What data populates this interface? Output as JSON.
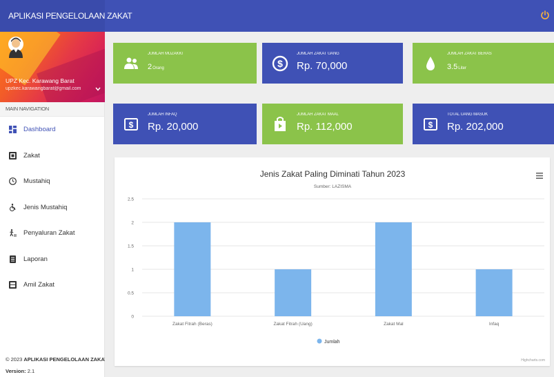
{
  "app": {
    "title": "APLIKASI PENGELOLAAN ZAKAT"
  },
  "profile": {
    "name": "UPZ Kec. Karawang Barat",
    "email": "upzkec.karawangbarat@gmail.com"
  },
  "nav": {
    "header": "MAIN NAVIGATION",
    "items": [
      {
        "label": "Dashboard",
        "icon": "dashboard-icon",
        "active": true
      },
      {
        "label": "Zakat",
        "icon": "zakat-icon"
      },
      {
        "label": "Mustahiq",
        "icon": "mustahiq-icon"
      },
      {
        "label": "Jenis Mustahiq",
        "icon": "wheelchair-icon"
      },
      {
        "label": "Penyaluran Zakat",
        "icon": "walking-icon"
      },
      {
        "label": "Laporan",
        "icon": "report-icon"
      },
      {
        "label": "Amil Zakat",
        "icon": "amil-icon"
      }
    ]
  },
  "footer": {
    "copyright_prefix": "© 2023 ",
    "copyright_app": "APLIKASI PENGELOLAAN ZAKAT.",
    "version_label": "Version:",
    "version": "2.1"
  },
  "cards": [
    {
      "label": "JUMLAH MUZAKKI",
      "value": "2",
      "unit": "Orang",
      "color": "#8bc34a",
      "icon": "users-icon"
    },
    {
      "label": "JUMLAH ZAKAT UANG",
      "value": "Rp. 70,000",
      "color": "#3f51b5",
      "icon": "dollar-icon"
    },
    {
      "label": "JUMLAH ZAKAT BERAS",
      "value": "3.5",
      "unit": "Liter",
      "color": "#8bc34a",
      "icon": "drop-icon"
    },
    {
      "label": "JUMLAH INFAQ",
      "value": "Rp. 20,000",
      "color": "#3f51b5",
      "icon": "money-icon"
    },
    {
      "label": "JUMLAH ZAKAT MAAL",
      "value": "Rp. 112,000",
      "color": "#8bc34a",
      "icon": "bag-icon"
    },
    {
      "label": "TOTAL UANG MASUK",
      "value": "Rp. 202,000",
      "color": "#3f51b5",
      "icon": "money-icon"
    }
  ],
  "colors": {
    "primary": "#3f51b5",
    "green": "#8bc34a",
    "bar": "#7cb5ec"
  },
  "chart_data": {
    "type": "bar",
    "title": "Jenis Zakat Paling Diminati Tahun 2023",
    "subtitle": "Sumber: LAZISMA",
    "categories": [
      "Zakat Fitrah (Beras)",
      "Zakat Fitrah (Uang)",
      "Zakat Mal",
      "Infaq"
    ],
    "series": [
      {
        "name": "Jumlah",
        "values": [
          2,
          1,
          2,
          1
        ]
      }
    ],
    "ylim": [
      0,
      2.5
    ],
    "yticks": [
      "0",
      "0.5",
      "1",
      "1.5",
      "2",
      "2.5"
    ],
    "grid": true,
    "legend": "bottom-center",
    "credits": "Highcharts.com"
  }
}
